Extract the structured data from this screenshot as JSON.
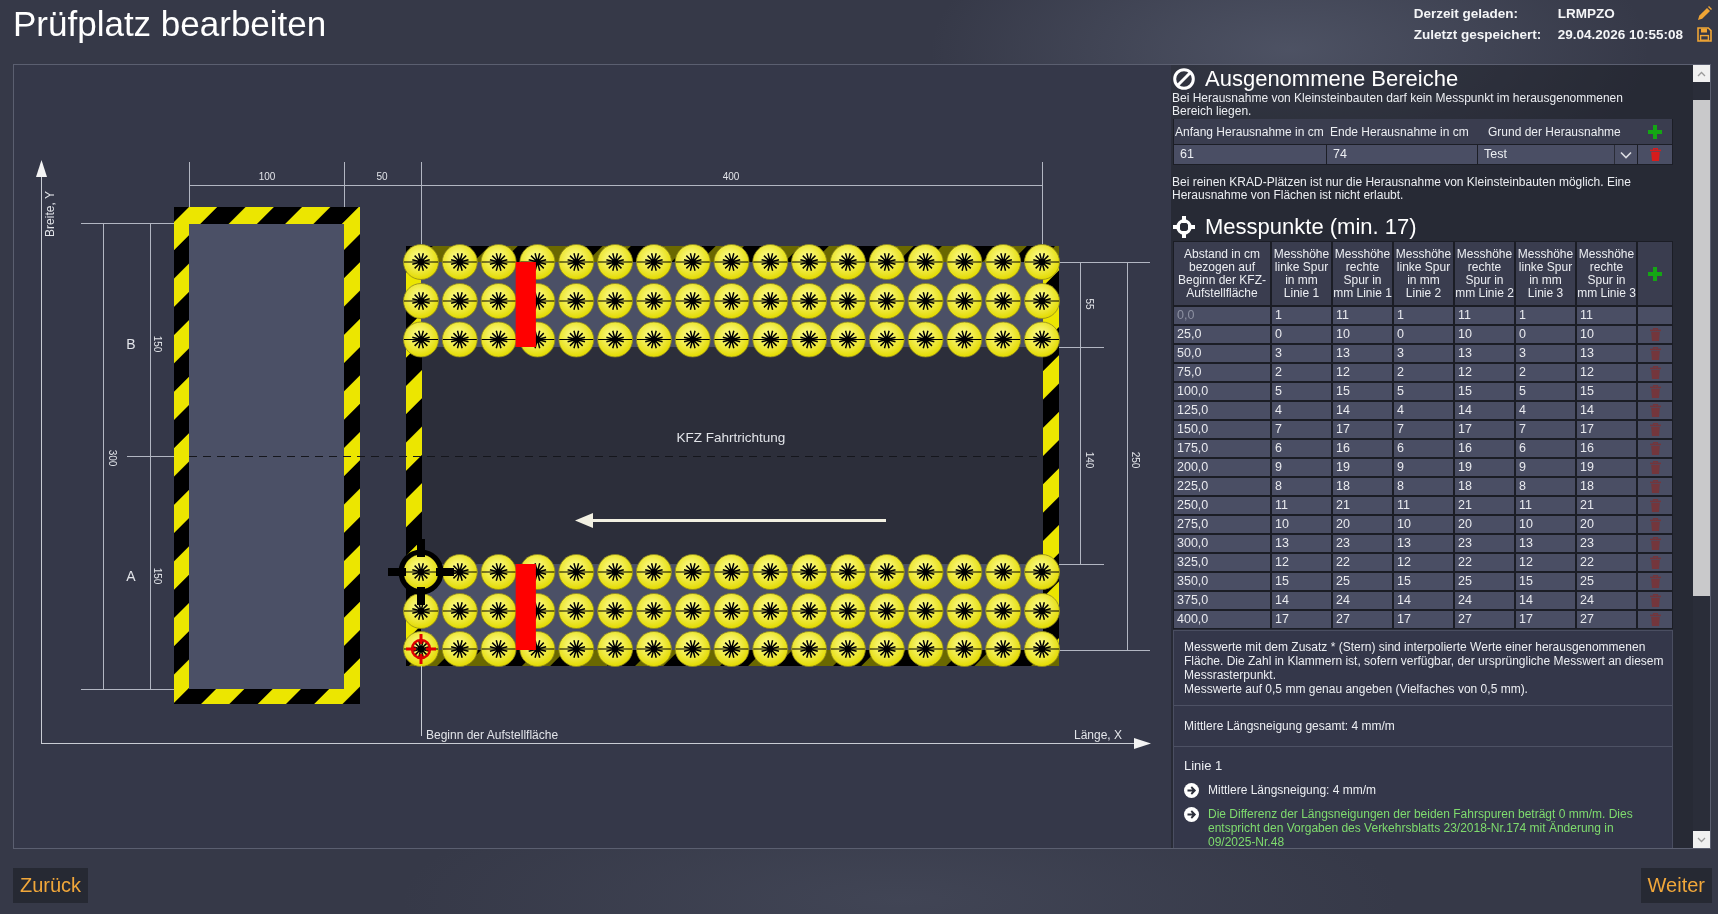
{
  "header": {
    "title": "Prüfplatz bearbeiten",
    "loaded": {
      "label": "Derzeit geladen:",
      "value": "LRMPZO"
    },
    "saved": {
      "label": "Zuletzt gespeichert:",
      "value": "29.04.2026 10:55:08"
    }
  },
  "diagram": {
    "y_axis_label": "Breite, Y",
    "x_axis_label": "Länge, X",
    "top_dimensions": [
      "100",
      "50",
      "400"
    ],
    "width_dimension": "300",
    "lane_dimensions": [
      "150",
      "150"
    ],
    "lane_labels": [
      "B",
      "A"
    ],
    "band_dimensions": [
      "55",
      "140"
    ],
    "plate_width_dimension": "250",
    "direction_label": "KFZ Fahrtrichtung",
    "start_label": "Beginn der Aufstellfläche"
  },
  "exclusions": {
    "title": "Ausgenommene Bereiche",
    "hint": "Bei Herausnahme von Kleinsteinbauten darf kein Messpunkt im herausgenommenen Bereich liegen.",
    "columns": [
      "Anfang Herausnahme in cm",
      "Ende Herausnahme in cm",
      "Grund der Herausnahme"
    ],
    "rows": [
      {
        "start": "61",
        "end": "74",
        "reason": "Test"
      }
    ],
    "note": "Bei reinen KRAD-Plätzen ist nur die Herausnahme von Kleinsteinbauten möglich. Eine Herausnahme von Flächen ist nicht erlaubt."
  },
  "measurements": {
    "title": "Messpunkte (min. 17)",
    "columns": [
      "Abstand in cm bezogen auf Beginn der KFZ-Aufstellfläche",
      "Messhöhe linke Spur in mm Linie 1",
      "Messhöhe rechte Spur in mm Linie 1",
      "Messhöhe linke Spur in mm Linie 2",
      "Messhöhe rechte Spur in mm Linie 2",
      "Messhöhe linke Spur in mm Linie 3",
      "Messhöhe rechte Spur in mm Linie 3"
    ],
    "rows": [
      {
        "values": [
          "0,0",
          "1",
          "11",
          "1",
          "11",
          "1",
          "11"
        ],
        "disabled": true
      },
      {
        "values": [
          "25,0",
          "0",
          "10",
          "0",
          "10",
          "0",
          "10"
        ],
        "disabled": false
      },
      {
        "values": [
          "50,0",
          "3",
          "13",
          "3",
          "13",
          "3",
          "13"
        ],
        "disabled": false
      },
      {
        "values": [
          "75,0",
          "2",
          "12",
          "2",
          "12",
          "2",
          "12"
        ],
        "disabled": false
      },
      {
        "values": [
          "100,0",
          "5",
          "15",
          "5",
          "15",
          "5",
          "15"
        ],
        "disabled": false
      },
      {
        "values": [
          "125,0",
          "4",
          "14",
          "4",
          "14",
          "4",
          "14"
        ],
        "disabled": false
      },
      {
        "values": [
          "150,0",
          "7",
          "17",
          "7",
          "17",
          "7",
          "17"
        ],
        "disabled": false
      },
      {
        "values": [
          "175,0",
          "6",
          "16",
          "6",
          "16",
          "6",
          "16"
        ],
        "disabled": false
      },
      {
        "values": [
          "200,0",
          "9",
          "19",
          "9",
          "19",
          "9",
          "19"
        ],
        "disabled": false
      },
      {
        "values": [
          "225,0",
          "8",
          "18",
          "8",
          "18",
          "8",
          "18"
        ],
        "disabled": false
      },
      {
        "values": [
          "250,0",
          "11",
          "21",
          "11",
          "21",
          "11",
          "21"
        ],
        "disabled": false
      },
      {
        "values": [
          "275,0",
          "10",
          "20",
          "10",
          "20",
          "10",
          "20"
        ],
        "disabled": false
      },
      {
        "values": [
          "300,0",
          "13",
          "23",
          "13",
          "23",
          "13",
          "23"
        ],
        "disabled": false
      },
      {
        "values": [
          "325,0",
          "12",
          "22",
          "12",
          "22",
          "12",
          "22"
        ],
        "disabled": false
      },
      {
        "values": [
          "350,0",
          "15",
          "25",
          "15",
          "25",
          "15",
          "25"
        ],
        "disabled": false
      },
      {
        "values": [
          "375,0",
          "14",
          "24",
          "14",
          "24",
          "14",
          "24"
        ],
        "disabled": false
      },
      {
        "values": [
          "400,0",
          "17",
          "27",
          "17",
          "27",
          "17",
          "27"
        ],
        "disabled": false
      }
    ]
  },
  "notes": {
    "paragraphs": [
      "Messwerte mit dem Zusatz * (Stern) sind interpolierte Werte einer herausgenommenen Fläche. Die Zahl in Klammern ist, sofern verfügbar, der ursprüngliche Messwert an diesem Messrasterpunkt.",
      "Messwerte auf 0,5 mm genau angeben (Vielfaches von 0,5 mm)."
    ],
    "mean_total": "Mittlere Längsneigung gesamt: 4 mm/m"
  },
  "lines": [
    {
      "title": "Linie 1",
      "items": [
        {
          "kind": "info",
          "text": "Mittlere Längsneigung: 4 mm/m"
        },
        {
          "kind": "success",
          "text": "Die Differenz der Längsneigungen der beiden Fahrspuren beträgt 0 mm/m. Dies entspricht den Vorgaben des Verkehrsblatts 23/2018-Nr.174 mit Änderung in 09/2025-Nr.48"
        }
      ]
    }
  ],
  "footer": {
    "back": "Zurück",
    "next": "Weiter"
  }
}
